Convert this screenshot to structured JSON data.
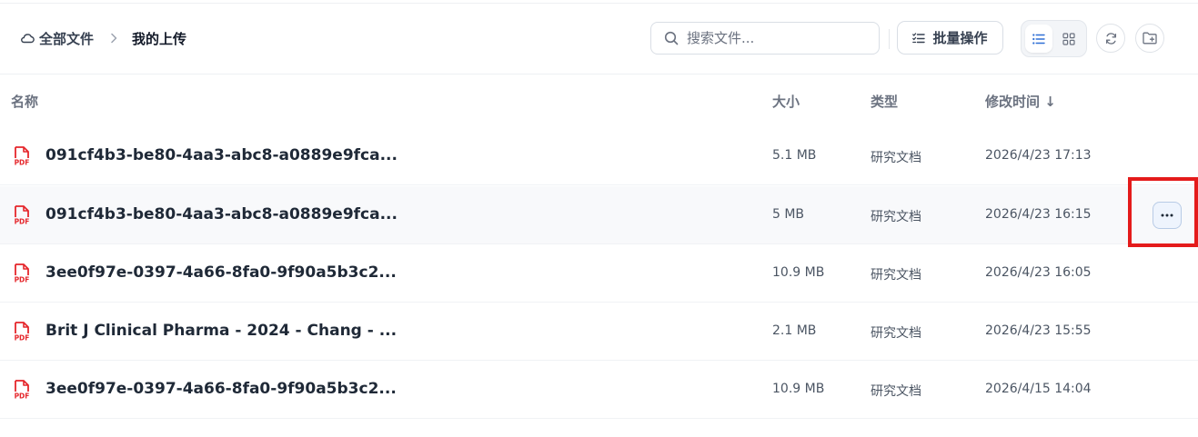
{
  "breadcrumb": {
    "root": "全部文件",
    "current": "我的上传",
    "root_icon": "cloud-icon",
    "separator_icon": "chevron-right-icon"
  },
  "search": {
    "placeholder": "搜索文件...",
    "value": ""
  },
  "toolbar": {
    "batch_label": "批量操作",
    "batch_icon": "checklist-icon",
    "view_modes": [
      "list-view-icon",
      "grid-view-icon"
    ],
    "active_view": "list",
    "refresh_icon": "refresh-icon",
    "new_folder_icon": "new-folder-icon"
  },
  "table": {
    "headers": {
      "name": "名称",
      "size": "大小",
      "type": "类型",
      "modified": "修改时间 ↓"
    },
    "rows": [
      {
        "name": "091cf4b3-be80-4aa3-abc8-a0889e9fca...",
        "size": "5.1 MB",
        "type": "研究文档",
        "modified": "2026/4/23 17:13",
        "icon": "pdf-icon"
      },
      {
        "name": "091cf4b3-be80-4aa3-abc8-a0889e9fca...",
        "size": "5 MB",
        "type": "研究文档",
        "modified": "2026/4/23 16:15",
        "icon": "pdf-icon"
      },
      {
        "name": "3ee0f97e-0397-4a66-8fa0-9f90a5b3c2...",
        "size": "10.9 MB",
        "type": "研究文档",
        "modified": "2026/4/23 16:05",
        "icon": "pdf-icon"
      },
      {
        "name": "Brit J Clinical Pharma - 2024 - Chang - ...",
        "size": "2.1 MB",
        "type": "研究文档",
        "modified": "2026/4/23 15:55",
        "icon": "pdf-icon"
      },
      {
        "name": "3ee0f97e-0397-4a66-8fa0-9f90a5b3c2...",
        "size": "10.9 MB",
        "type": "研究文档",
        "modified": "2026/4/15 14:04",
        "icon": "pdf-icon"
      }
    ],
    "hovered_row": 1,
    "row_more_icon": "more-horizontal-icon"
  },
  "colors": {
    "pdf_red": "#e5262b",
    "highlight": "#e41b1b",
    "accent_blue": "#2f6fd6"
  },
  "pdf_icon_text": "PDF"
}
